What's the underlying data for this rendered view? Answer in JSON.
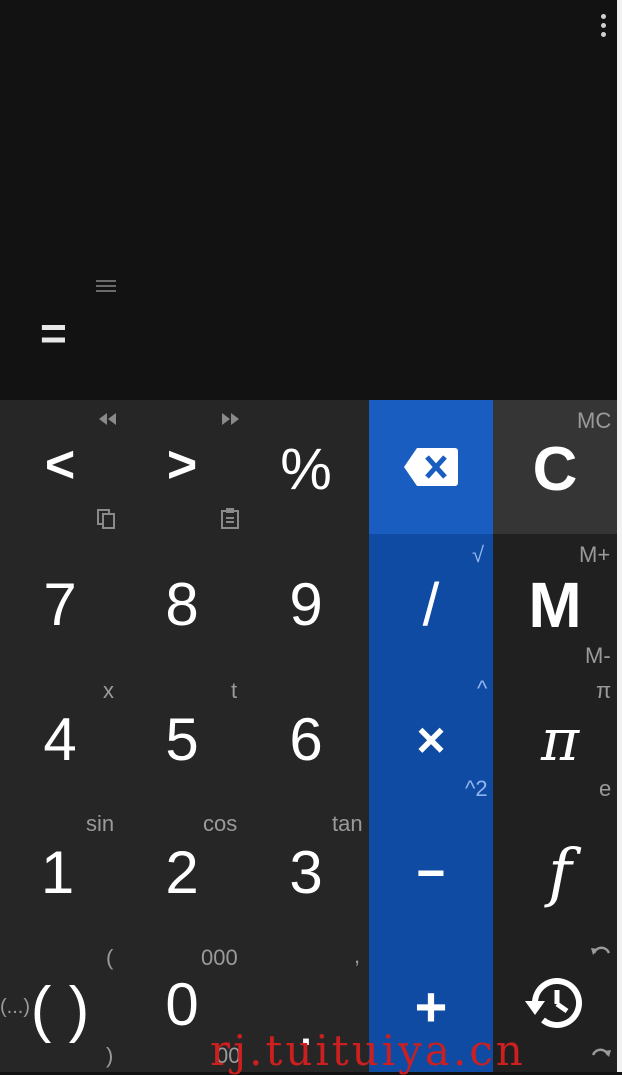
{
  "display": {
    "equals": "="
  },
  "keys": {
    "left_label": "<",
    "right_label": ">",
    "percent_label": "%",
    "clear_label": "C",
    "seven": "7",
    "eight": "8",
    "nine": "9",
    "divide_label": "/",
    "memory_label": "M",
    "four": "4",
    "five": "5",
    "six": "6",
    "multiply_label": "×",
    "pi_label": "π",
    "one": "1",
    "two": "2",
    "three": "3",
    "minus_label": "−",
    "function_label": "f",
    "parens_label": "( )",
    "zero": "0",
    "decimal_label": ".",
    "plus_label": "+"
  },
  "hints": {
    "mc": "MC",
    "m_plus": "M+",
    "m_minus": "M-",
    "sqrt": "√",
    "power": "^",
    "square": "^2",
    "x": "x",
    "t": "t",
    "pi_small": "π",
    "e": "e",
    "sin": "sin",
    "cos": "cos",
    "tan": "tan",
    "open_paren": "(",
    "close_paren": ")",
    "ellipsis_paren": "(...)",
    "triple_zero": "000",
    "double_zero": "00",
    "comma": ","
  },
  "watermark": "rj.tuituiya.cn",
  "colors": {
    "display_bg": "#121212",
    "keypad_bg": "#262626",
    "operator_blue": "#0f4ba3",
    "backspace_blue": "#1a5dc0",
    "clear_bg": "#353535",
    "watermark_red": "#cc1f1f"
  },
  "icons": [
    "overflow-menu-icon",
    "drag-handle-icon",
    "rewind-icon",
    "fast-forward-icon",
    "copy-icon",
    "paste-icon",
    "backspace-icon",
    "history-icon",
    "undo-icon",
    "redo-icon"
  ]
}
